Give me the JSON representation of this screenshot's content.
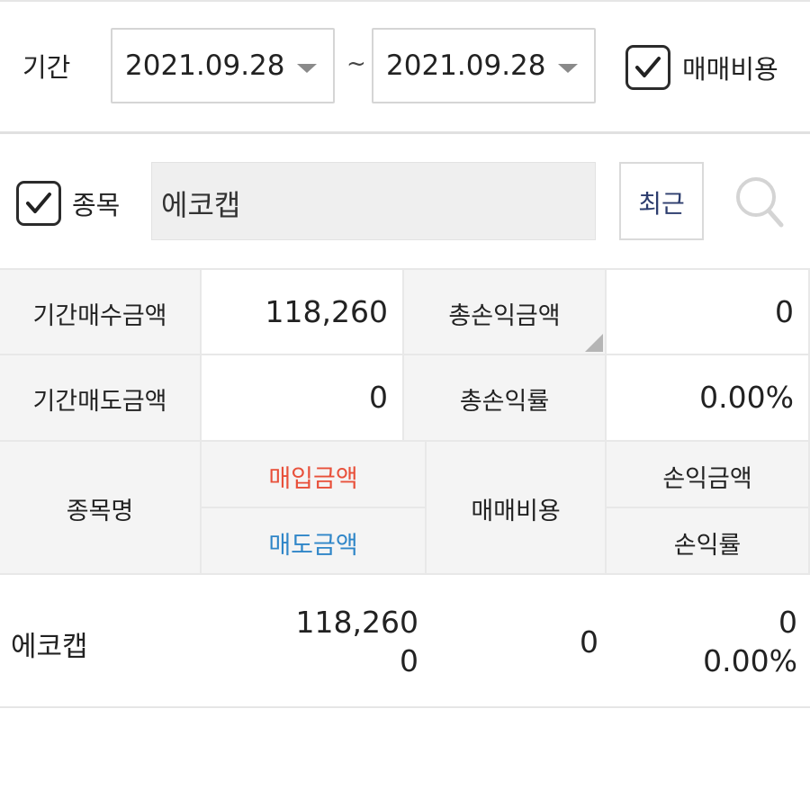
{
  "filter": {
    "period_label": "기간",
    "date_from": "2021.09.28",
    "date_to": "2021.09.28",
    "separator": "~",
    "fee_label": "매매비용",
    "fee_checked": true
  },
  "stock": {
    "label": "종목",
    "checked": true,
    "value": "에코캡",
    "recent_button": "최근"
  },
  "summary": {
    "period_buy_label": "기간매수금액",
    "period_buy_value": "118,260",
    "total_pl_label": "총손익금액",
    "total_pl_value": "0",
    "period_sell_label": "기간매도금액",
    "period_sell_value": "0",
    "total_pl_rate_label": "총손익률",
    "total_pl_rate_value": "0.00%"
  },
  "table": {
    "headers": {
      "name": "종목명",
      "buy_amount": "매입금액",
      "sell_amount": "매도금액",
      "fee": "매매비용",
      "pl_amount": "손익금액",
      "pl_rate": "손익률"
    },
    "rows": [
      {
        "name": "에코캡",
        "buy_amount": "118,260",
        "sell_amount": "0",
        "fee": "0",
        "pl_amount": "0",
        "pl_rate": "0.00%"
      }
    ]
  },
  "colors": {
    "buy_header": "#e8503a",
    "sell_header": "#2f86c8"
  },
  "icons": [
    "checkbox-checked-icon",
    "chevron-down-icon",
    "search-icon"
  ]
}
